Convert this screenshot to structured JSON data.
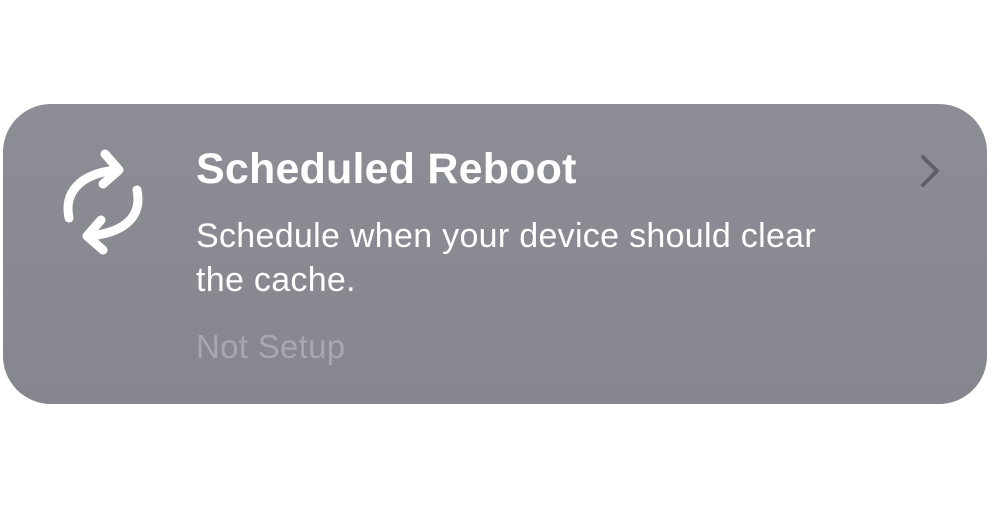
{
  "card": {
    "title": "Scheduled Reboot",
    "description": "Schedule when your device should clear the cache.",
    "status": "Not Setup",
    "icon": "refresh-icon",
    "chevron_icon": "chevron-right-icon"
  },
  "colors": {
    "card_background": "#8a8a92",
    "title_text": "#ffffff",
    "description_text": "#ffffff",
    "status_text": "#a7a7ad",
    "chevron": "#5f5f66"
  }
}
